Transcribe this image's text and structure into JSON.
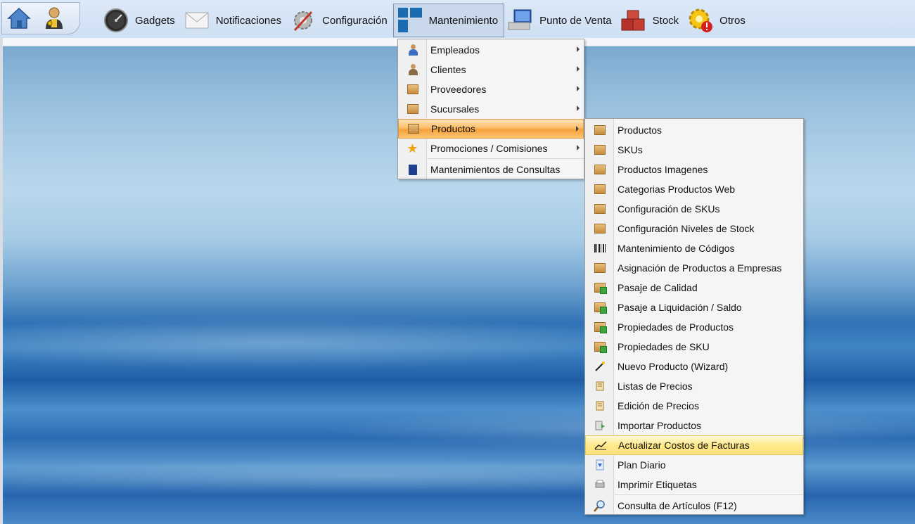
{
  "toolbar": {
    "quick_buttons": [
      {
        "icon": "home-icon"
      },
      {
        "icon": "user-key-icon"
      }
    ],
    "menu": [
      {
        "label": "Gadgets",
        "icon": "gauge-icon"
      },
      {
        "label": "Notificaciones",
        "icon": "envelope-icon"
      },
      {
        "label": "Configuración",
        "icon": "wrench-gear-icon"
      },
      {
        "label": "Mantenimiento",
        "icon": "tiles-icon",
        "active": true
      },
      {
        "label": "Punto de Venta",
        "icon": "pos-terminal-icon"
      },
      {
        "label": "Stock",
        "icon": "bricks-icon"
      },
      {
        "label": "Otros",
        "icon": "gear-alert-icon"
      }
    ]
  },
  "mantenimiento_menu": [
    {
      "label": "Empleados",
      "icon": "employee-icon",
      "submenu": true
    },
    {
      "label": "Clientes",
      "icon": "client-icon",
      "submenu": true
    },
    {
      "label": "Proveedores",
      "icon": "supplier-icon",
      "submenu": true
    },
    {
      "label": "Sucursales",
      "icon": "branches-icon",
      "submenu": true
    },
    {
      "label": "Productos",
      "icon": "product-box-icon",
      "submenu": true,
      "highlighted": true
    },
    {
      "label": "Promociones / Comisiones",
      "icon": "star-icon",
      "submenu": true
    },
    {
      "label": "Mantenimientos de Consultas",
      "icon": "document-icon",
      "submenu": false
    }
  ],
  "productos_menu": [
    {
      "label": "Productos",
      "icon": "product-box-icon"
    },
    {
      "label": "SKUs",
      "icon": "product-box-icon"
    },
    {
      "label": "Productos Imagenes",
      "icon": "product-box-icon"
    },
    {
      "label": "Categorias Productos Web",
      "icon": "product-box-icon"
    },
    {
      "label": "Configuración de SKUs",
      "icon": "box-tool-icon"
    },
    {
      "label": "Configuración Niveles de Stock",
      "icon": "box-tool-icon"
    },
    {
      "label": "Mantenimiento de Códigos",
      "icon": "barcode-icon"
    },
    {
      "label": "Asignación de Productos a Empresas",
      "icon": "stacked-boxes-icon"
    },
    {
      "label": "Pasaje de Calidad",
      "icon": "box-green-icon"
    },
    {
      "label": "Pasaje a Liquidación / Saldo",
      "icon": "box-green-icon"
    },
    {
      "label": "Propiedades de Productos",
      "icon": "box-green-icon"
    },
    {
      "label": "Propiedades de SKU",
      "icon": "box-green-icon"
    },
    {
      "label": "Nuevo Producto (Wizard)",
      "icon": "magic-wand-icon"
    },
    {
      "label": "Listas de Precios",
      "icon": "price-list-icon"
    },
    {
      "label": "Edición de Precios",
      "icon": "price-list-icon"
    },
    {
      "label": "Importar Productos",
      "icon": "import-icon"
    },
    {
      "label": "Actualizar Costos de Facturas",
      "icon": "chart-update-icon",
      "highlighted": true
    },
    {
      "label": "Plan Diario",
      "icon": "download-arrow-icon"
    },
    {
      "label": "Imprimir Etiquetas",
      "icon": "label-printer-icon"
    },
    {
      "label": "Consulta de Artículos (F12)",
      "icon": "magnifier-icon",
      "separator_before": true
    }
  ]
}
